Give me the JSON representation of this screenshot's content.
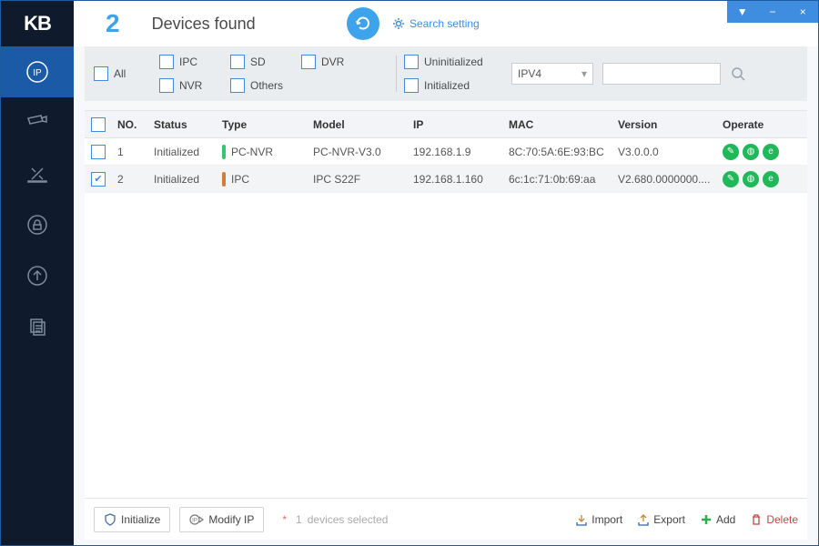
{
  "count": "2",
  "title": "Devices found",
  "search_setting": "Search setting",
  "filters": {
    "all": "All",
    "ipc": "IPC",
    "sd": "SD",
    "dvr": "DVR",
    "nvr": "NVR",
    "others": "Others",
    "uninit": "Uninitialized",
    "init": "Initialized"
  },
  "select_value": "IPV4",
  "columns": {
    "no": "NO.",
    "status": "Status",
    "type": "Type",
    "model": "Model",
    "ip": "IP",
    "mac": "MAC",
    "version": "Version",
    "operate": "Operate"
  },
  "rows": [
    {
      "checked": false,
      "no": "1",
      "status": "Initialized",
      "type": "PC-NVR",
      "bar": "#31c96e",
      "model": "PC-NVR-V3.0",
      "ip": "192.168.1.9",
      "mac": "8C:70:5A:6E:93:BC",
      "version": "V3.0.0.0"
    },
    {
      "checked": true,
      "no": "2",
      "status": "Initialized",
      "type": "IPC",
      "bar": "#d47c38",
      "model": "IPC S22F",
      "ip": "192.168.1.160",
      "mac": "6c:1c:71:0b:69:aa",
      "version": "V2.680.0000000...."
    }
  ],
  "footer": {
    "initialize": "Initialize",
    "modify_ip": "Modify IP",
    "selected_count": "1",
    "selected_text": "devices selected",
    "import": "Import",
    "export": "Export",
    "add": "Add",
    "delete": "Delete"
  }
}
